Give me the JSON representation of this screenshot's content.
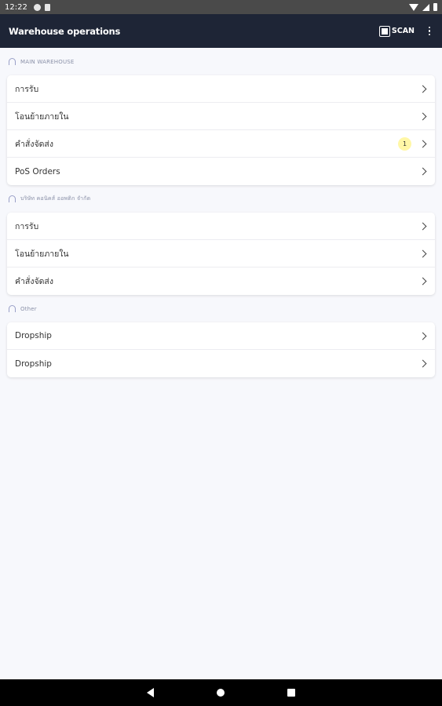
{
  "status_bar": {
    "time": "12:22"
  },
  "app_bar": {
    "title": "Warehouse operations",
    "scan_label": "SCAN"
  },
  "sections": [
    {
      "title": "MAIN WAREHOUSE",
      "items": [
        {
          "label": "การรับ"
        },
        {
          "label": "โอนย้ายภายใน"
        },
        {
          "label": "คำสั่งจัดส่ง",
          "badge": "1"
        },
        {
          "label": "PoS Orders"
        }
      ]
    },
    {
      "title": "บริษัท คอนิคส์ ออพติก จำกัด",
      "items": [
        {
          "label": "การรับ"
        },
        {
          "label": "โอนย้ายภายใน"
        },
        {
          "label": "คำสั่งจัดส่ง"
        }
      ]
    },
    {
      "title": "Other",
      "items": [
        {
          "label": "Dropship"
        },
        {
          "label": "Dropship"
        }
      ]
    }
  ]
}
